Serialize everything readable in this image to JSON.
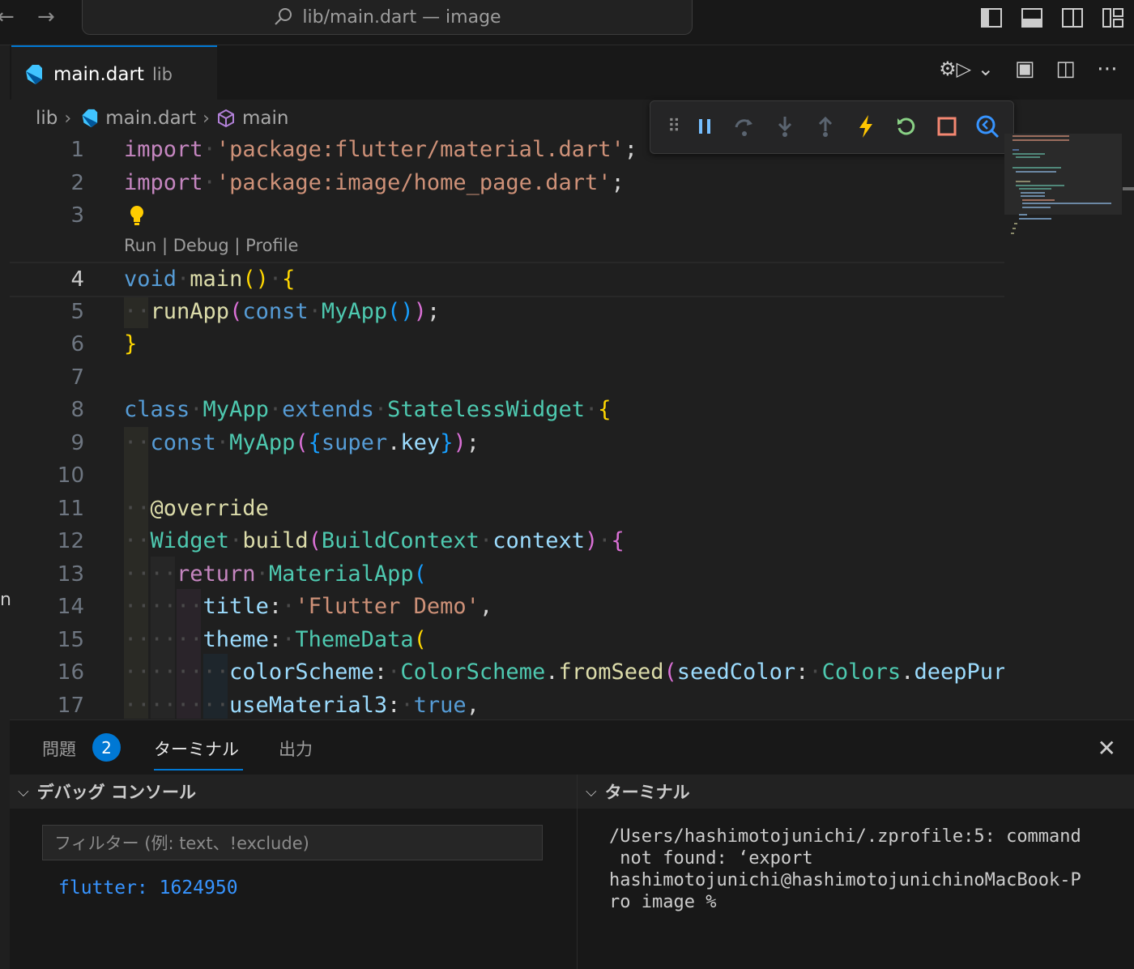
{
  "titlebar": {
    "search_text": "lib/main.dart — image",
    "back_icon": "arrow-left-icon",
    "forward_icon": "arrow-right-icon"
  },
  "tab": {
    "file_name": "main.dart",
    "description": "lib"
  },
  "breadcrumb": {
    "folder": "lib",
    "file": "main.dart",
    "symbol": "main"
  },
  "codelens": "Run | Debug | Profile",
  "line_numbers": [
    "1",
    "2",
    "3",
    "4",
    "5",
    "6",
    "7",
    "8",
    "9",
    "10",
    "11",
    "12",
    "13",
    "14",
    "15",
    "16",
    "17"
  ],
  "code": {
    "l1_kw": "import",
    "l1_str": "'package:flutter/material.dart'",
    "l2_kw": "import",
    "l2_str": "'package:image/home_page.dart'",
    "l4_kw": "void",
    "l4_fn": "main",
    "l5_fn": "runApp",
    "l5_kw": "const",
    "l5_ty": "MyApp",
    "l8_kw": "class",
    "l8_ty": "MyApp",
    "l8_kw2": "extends",
    "l8_ty2": "StatelessWidget",
    "l9_kw": "const",
    "l9_ty": "MyApp",
    "l9_kw2": "super",
    "l9_var": "key",
    "l11_ann": "@override",
    "l12_ty": "Widget",
    "l12_fn": "build",
    "l12_ty2": "BuildContext",
    "l12_var": "context",
    "l13_kw": "return",
    "l13_ty": "MaterialApp",
    "l14_var": "title",
    "l14_str": "'Flutter Demo'",
    "l15_var": "theme",
    "l15_ty": "ThemeData",
    "l16_var": "colorScheme",
    "l16_ty": "ColorScheme",
    "l16_fn": "fromSeed",
    "l16_var2": "seedColor",
    "l16_ty2": "Colors",
    "l16_var3": "deepPur",
    "l17_var": "useMaterial3",
    "l17_kw": "true"
  },
  "panel": {
    "tabs": [
      {
        "label": "問題"
      },
      {
        "label": "ターミナル"
      },
      {
        "label": "出力"
      }
    ],
    "problems_count": "2",
    "debug_console_title": "デバッグ コンソール",
    "terminal_title": "ターミナル",
    "filter_placeholder": "フィルター (例: text、!exclude)",
    "console_output": "flutter: 1624950",
    "terminal_output": "/Users/hashimotojunichi/.zprofile:5: command\n not found: ‘export\nhashimotojunichi@hashimotojunichinoMacBook-P\nro image %"
  },
  "left_edge_char": "n",
  "colors": {
    "accent": "#0078d4",
    "background": "#1f1f1f",
    "keyword": "#569cd6",
    "string": "#ce9178",
    "type": "#4ec9b0"
  }
}
